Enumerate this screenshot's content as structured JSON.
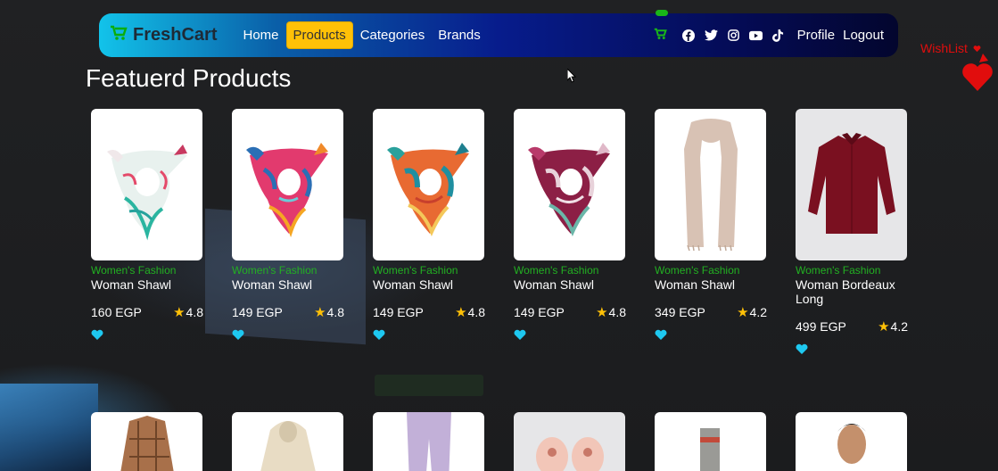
{
  "app": {
    "brand": "FreshCart",
    "nav_links": [
      "Home",
      "Products",
      "Categories",
      "Brands"
    ],
    "active_link": "Products",
    "profile_label": "Profile",
    "logout_label": "Logout",
    "wishlist_label": "WishList"
  },
  "page": {
    "title": "Featuerd Products"
  },
  "products": [
    {
      "category": "Women's Fashion",
      "title": "Woman Shawl",
      "price": "160 EGP",
      "rating": "4.8",
      "image": "white-teal-silk-scarf"
    },
    {
      "category": "Women's Fashion",
      "title": "Woman Shawl",
      "price": "149 EGP",
      "rating": "4.8",
      "image": "pink-blue-silk-scarf"
    },
    {
      "category": "Women's Fashion",
      "title": "Woman Shawl",
      "price": "149 EGP",
      "rating": "4.8",
      "image": "orange-teal-silk-scarf"
    },
    {
      "category": "Women's Fashion",
      "title": "Woman Shawl",
      "price": "149 EGP",
      "rating": "4.8",
      "image": "burgundy-silk-scarf"
    },
    {
      "category": "Women's Fashion",
      "title": "Woman Shawl",
      "price": "349 EGP",
      "rating": "4.2",
      "image": "beige-long-scarf"
    },
    {
      "category": "Women's Fashion",
      "title": "Woman Bordeaux Long",
      "price": "499 EGP",
      "rating": "4.2",
      "image": "bordeaux-shirt"
    }
  ],
  "colors": {
    "accent_green": "#22b022",
    "active_nav": "#ffc107",
    "wishlist_red": "#e10d0d",
    "heart_blue": "#1ec8f0",
    "star_yellow": "#ffc107"
  }
}
